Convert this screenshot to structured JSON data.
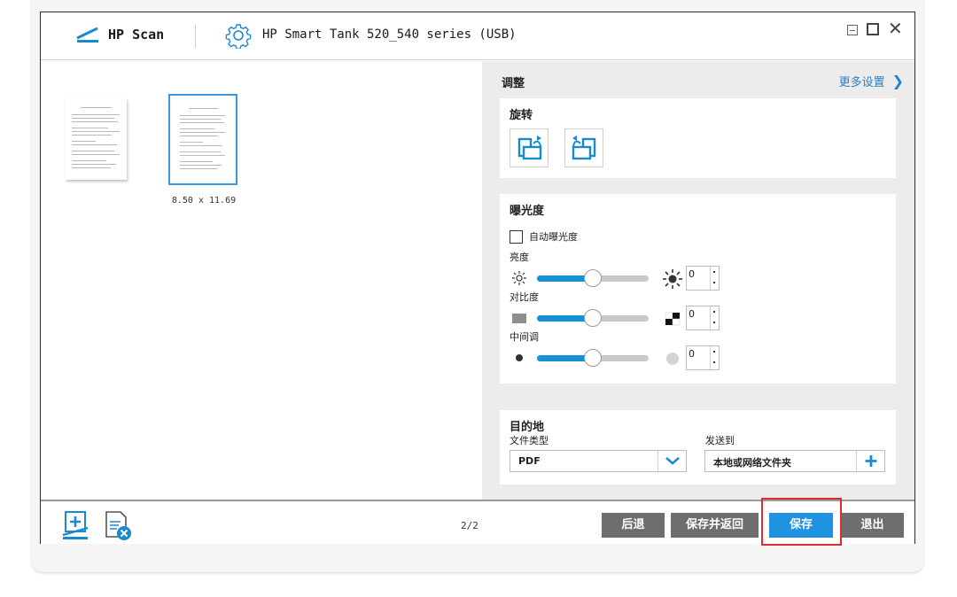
{
  "window": {
    "app_name": "HP Scan",
    "device_name": "HP Smart Tank 520_540 series (USB)"
  },
  "preview": {
    "selected_page_size": "8.50 x 11.69",
    "page_count": "2/2"
  },
  "adjust": {
    "title": "调整",
    "more_settings": "更多设置",
    "rotate": {
      "title": "旋转"
    },
    "exposure": {
      "title": "曝光度",
      "auto_exposure_label": "自动曝光度",
      "auto_exposure_checked": false,
      "brightness": {
        "label": "亮度",
        "value": "0",
        "level": 0.5
      },
      "contrast": {
        "label": "对比度",
        "value": "0",
        "level": 0.5
      },
      "midtone": {
        "label": "中间调",
        "value": "0",
        "level": 0.5
      }
    },
    "destination": {
      "title": "目的地",
      "file_type_label": "文件类型",
      "file_type_value": "PDF",
      "send_to_label": "发送到",
      "send_to_value": "本地或网络文件夹"
    }
  },
  "actions": {
    "back": "后退",
    "save_and_return": "保存并返回",
    "save": "保存",
    "exit": "退出"
  },
  "colors": {
    "accent": "#1f93e1",
    "highlight": "#e02c2c",
    "button_gray": "#6e6e6e"
  }
}
